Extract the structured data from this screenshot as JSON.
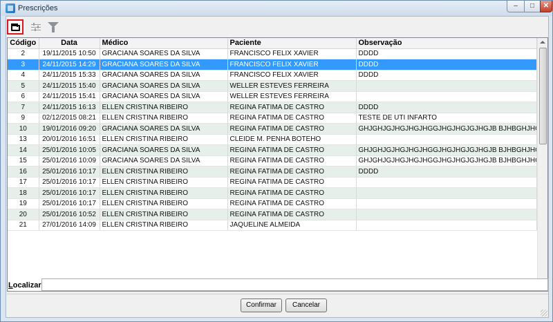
{
  "window": {
    "title": "Prescrições"
  },
  "toolbar": {
    "icons": [
      "folder-open-icon",
      "adjust-sliders-icon",
      "filter-icon"
    ]
  },
  "grid": {
    "columns": [
      "Código",
      "Data",
      "Médico",
      "Paciente",
      "Observação"
    ],
    "selected_row_index": 1,
    "rows": [
      {
        "codigo": "2",
        "data": "19/11/2015 10:50",
        "medico": "GRACIANA SOARES DA SILVA",
        "paciente": "FRANCISCO FELIX XAVIER",
        "obs": "DDDD"
      },
      {
        "codigo": "3",
        "data": "24/11/2015 14:29",
        "medico": "GRACIANA SOARES DA SILVA",
        "paciente": "FRANCISCO FELIX XAVIER",
        "obs": "DDDD"
      },
      {
        "codigo": "4",
        "data": "24/11/2015 15:33",
        "medico": "GRACIANA SOARES DA SILVA",
        "paciente": "FRANCISCO FELIX XAVIER",
        "obs": "DDDD"
      },
      {
        "codigo": "5",
        "data": "24/11/2015 15:40",
        "medico": "GRACIANA SOARES DA SILVA",
        "paciente": "WELLER ESTEVES FERREIRA",
        "obs": ""
      },
      {
        "codigo": "6",
        "data": "24/11/2015 15:41",
        "medico": "GRACIANA SOARES DA SILVA",
        "paciente": "WELLER ESTEVES FERREIRA",
        "obs": ""
      },
      {
        "codigo": "7",
        "data": "24/11/2015 16:13",
        "medico": "ELLEN CRISTINA RIBEIRO",
        "paciente": "REGINA FATIMA DE CASTRO",
        "obs": "DDDD"
      },
      {
        "codigo": "9",
        "data": "02/12/2015 08:21",
        "medico": "ELLEN CRISTINA RIBEIRO",
        "paciente": "REGINA FATIMA DE CASTRO",
        "obs": "TESTE DE UTI INFARTO"
      },
      {
        "codigo": "10",
        "data": "19/01/2016 09:20",
        "medico": "GRACIANA SOARES DA SILVA",
        "paciente": "REGINA FATIMA DE CASTRO",
        "obs": "GHJGHJGJHGJHGJHGGJHGJHGJGJHGJB BJHBGHJHG  HGHHG HJGJ"
      },
      {
        "codigo": "13",
        "data": "20/01/2016 16:51",
        "medico": "ELLEN CRISTINA RIBEIRO",
        "paciente": "CLEIDE M. PENHA BOTEHO",
        "obs": ""
      },
      {
        "codigo": "14",
        "data": "25/01/2016 10:05",
        "medico": "GRACIANA SOARES DA SILVA",
        "paciente": "REGINA FATIMA DE CASTRO",
        "obs": "GHJGHJGJHGJHGJHGGJHGJHGJGJHGJB BJHBGHJHG  HGHHG HJGJ"
      },
      {
        "codigo": "15",
        "data": "25/01/2016 10:09",
        "medico": "GRACIANA SOARES DA SILVA",
        "paciente": "REGINA FATIMA DE CASTRO",
        "obs": "GHJGHJGJHGJHGJHGGJHGJHGJGJHGJB BJHBGHJHG  HGHHG HJGJ"
      },
      {
        "codigo": "16",
        "data": "25/01/2016 10:17",
        "medico": "ELLEN CRISTINA RIBEIRO",
        "paciente": "REGINA FATIMA DE CASTRO",
        "obs": "DDDD"
      },
      {
        "codigo": "17",
        "data": "25/01/2016 10:17",
        "medico": "ELLEN CRISTINA RIBEIRO",
        "paciente": "REGINA FATIMA DE CASTRO",
        "obs": ""
      },
      {
        "codigo": "18",
        "data": "25/01/2016 10:17",
        "medico": "ELLEN CRISTINA RIBEIRO",
        "paciente": "REGINA FATIMA DE CASTRO",
        "obs": ""
      },
      {
        "codigo": "19",
        "data": "25/01/2016 10:17",
        "medico": "ELLEN CRISTINA RIBEIRO",
        "paciente": "REGINA FATIMA DE CASTRO",
        "obs": ""
      },
      {
        "codigo": "20",
        "data": "25/01/2016 10:52",
        "medico": "ELLEN CRISTINA RIBEIRO",
        "paciente": "REGINA FATIMA DE CASTRO",
        "obs": ""
      },
      {
        "codigo": "21",
        "data": "27/01/2016 14:09",
        "medico": "ELLEN CRISTINA RIBEIRO",
        "paciente": "JAQUELINE ALMEIDA",
        "obs": ""
      }
    ]
  },
  "search": {
    "label_prefix": "L",
    "label_rest": "ocalizar:",
    "value": ""
  },
  "buttons": {
    "confirm": "Confirmar",
    "cancel": "Cancelar"
  },
  "colors": {
    "selection": "#3399ff",
    "alt_row": "#e6efe9",
    "highlight_border": "#e0151e"
  }
}
